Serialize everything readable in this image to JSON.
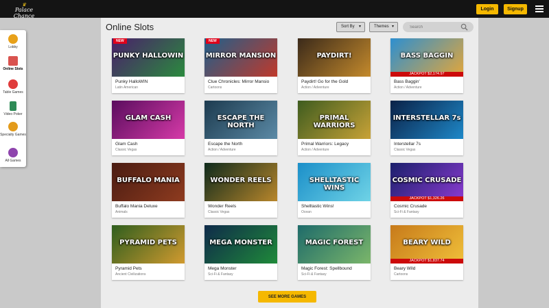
{
  "header": {
    "logo_text": "Palace Chance",
    "login_label": "Login",
    "signup_label": "Signup",
    "menu_icon": "hamburger-icon"
  },
  "sidebar": {
    "items": [
      {
        "label": "Lobby",
        "icon": "lobby-icon",
        "color": "#e8a11a"
      },
      {
        "label": "Online Slots",
        "icon": "slots-icon",
        "color": "#d9534f"
      },
      {
        "label": "Table Games",
        "icon": "table-games-icon",
        "color": "#e03c3c"
      },
      {
        "label": "Video Poker",
        "icon": "video-poker-icon",
        "color": "#2e8b57"
      },
      {
        "label": "Specialty Games",
        "icon": "specialty-games-icon",
        "color": "#e39b1b"
      },
      {
        "label": "All Games",
        "icon": "all-games-icon",
        "color": "#8e44ad"
      }
    ]
  },
  "main": {
    "title": "Online Slots",
    "sort_label": "Sort By",
    "themes_label": "Themes",
    "search_placeholder": "Search",
    "see_more_label": "SEE MORE GAMES"
  },
  "games": [
    {
      "name": "Punky HalloWIN",
      "category": "Latin American",
      "thumb_text": "PUNKY HALLOWIN",
      "new_label": "NEW",
      "jackpot": "",
      "bg": [
        "#4a1f6b",
        "#2b8a3e"
      ]
    },
    {
      "name": "Clue Chronicles: Mirror Mansio",
      "category": "Cartoons",
      "thumb_text": "MIRROR MANSION",
      "new_label": "NEW",
      "jackpot": "",
      "bg": [
        "#1f5f8b",
        "#c0392b"
      ]
    },
    {
      "name": "Paydirt! Go for the Gold",
      "category": "Action / Adventure",
      "thumb_text": "PAYDIRT!",
      "new_label": "",
      "jackpot": "",
      "bg": [
        "#3b2a1a",
        "#c48a2c"
      ]
    },
    {
      "name": "Bass Baggin'",
      "category": "Action / Adventure",
      "thumb_text": "BASS BAGGIN",
      "new_label": "",
      "jackpot": "JACKPOT $2,174.97",
      "bg": [
        "#2d8fd0",
        "#e3a63a"
      ]
    },
    {
      "name": "Glam Cash",
      "category": "Classic Vegas",
      "thumb_text": "GLAM CASH",
      "new_label": "",
      "jackpot": "",
      "bg": [
        "#5a0d5e",
        "#d63aa8"
      ]
    },
    {
      "name": "Escape the North",
      "category": "Action / Adventure",
      "thumb_text": "ESCAPE THE NORTH",
      "new_label": "",
      "jackpot": "",
      "bg": [
        "#1d3b4f",
        "#5b8aa6"
      ]
    },
    {
      "name": "Primal Warriors: Legacy",
      "category": "Action / Adventure",
      "thumb_text": "PRIMAL WARRIORS",
      "new_label": "",
      "jackpot": "",
      "bg": [
        "#3e5c1f",
        "#c8a237"
      ]
    },
    {
      "name": "Interstellar 7s",
      "category": "Classic Vegas",
      "thumb_text": "INTERSTELLAR 7s",
      "new_label": "",
      "jackpot": "",
      "bg": [
        "#0b2147",
        "#1e88c8"
      ]
    },
    {
      "name": "Buffalo Mania Deluxe",
      "category": "Animals",
      "thumb_text": "BUFFALO MANIA",
      "new_label": "",
      "jackpot": "",
      "bg": [
        "#4a1c12",
        "#8e3b1f"
      ]
    },
    {
      "name": "Wonder Reels",
      "category": "Classic Vegas",
      "thumb_text": "WONDER REELS",
      "new_label": "",
      "jackpot": "",
      "bg": [
        "#0e2a1c",
        "#b8862b"
      ]
    },
    {
      "name": "Shelltastic Wins!",
      "category": "Ocean",
      "thumb_text": "SHELLTASTIC WINS",
      "new_label": "",
      "jackpot": "",
      "bg": [
        "#1b8fc9",
        "#6fd3e6"
      ]
    },
    {
      "name": "Cosmic Crusade",
      "category": "Sci-Fi & Fantasy",
      "thumb_text": "COSMIC CRUSADE",
      "new_label": "",
      "jackpot": "JACKPOT $1,326.26",
      "bg": [
        "#1a1f6b",
        "#8b3bd1"
      ]
    },
    {
      "name": "Pyramid Pets",
      "category": "Ancient Civilizations",
      "thumb_text": "PYRAMID PETS",
      "new_label": "",
      "jackpot": "",
      "bg": [
        "#2f5e1e",
        "#d19a2f"
      ]
    },
    {
      "name": "Mega Monster",
      "category": "Sci-Fi & Fantasy",
      "thumb_text": "MEGA MONSTER",
      "new_label": "",
      "jackpot": "",
      "bg": [
        "#0f2a4a",
        "#1f8a3a"
      ]
    },
    {
      "name": "Magic Forest: Spellbound",
      "category": "Sci-Fi & Fantasy",
      "thumb_text": "MAGIC FOREST",
      "new_label": "",
      "jackpot": "",
      "bg": [
        "#1e6b6a",
        "#7bb66a"
      ]
    },
    {
      "name": "Beary Wild",
      "category": "Cartoons",
      "thumb_text": "BEARY WILD",
      "new_label": "",
      "jackpot": "JACKPOT $1,837.74",
      "bg": [
        "#c77a1a",
        "#f0c03a"
      ]
    }
  ]
}
